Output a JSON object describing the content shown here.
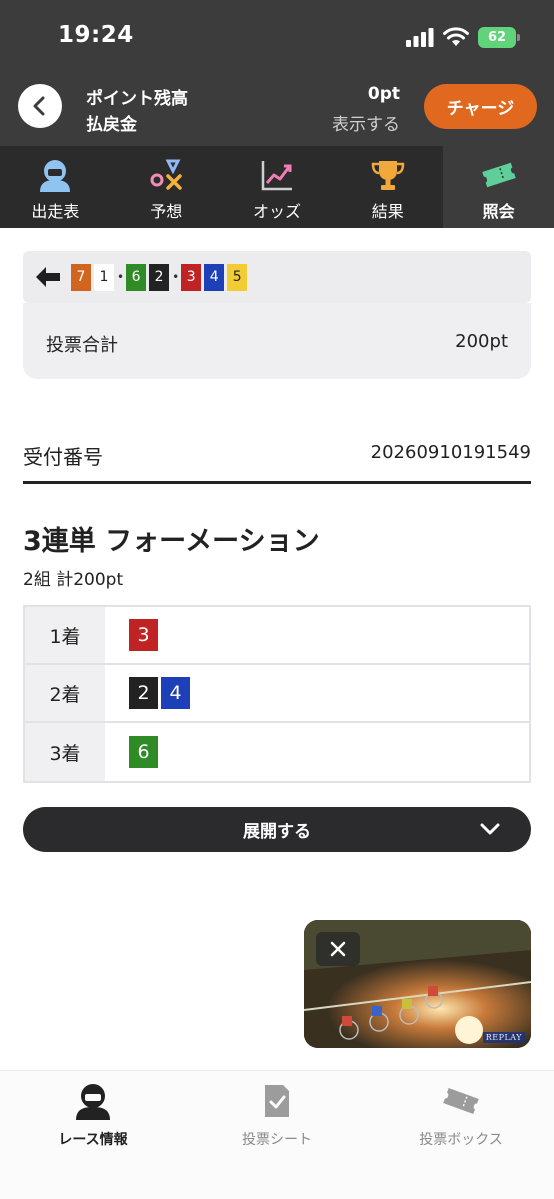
{
  "status_bar": {
    "time": "19:24",
    "battery": "62"
  },
  "header": {
    "point_label": "ポイント残高",
    "refund_label": "払戻金",
    "point_value": "0pt",
    "show_link": "表示する",
    "charge_label": "チャージ"
  },
  "tabs": [
    {
      "label": "出走表",
      "icon": "racer-icon"
    },
    {
      "label": "予想",
      "icon": "prediction-icon"
    },
    {
      "label": "オッズ",
      "icon": "odds-chart-icon"
    },
    {
      "label": "結果",
      "icon": "trophy-icon"
    },
    {
      "label": "照会",
      "icon": "ticket-icon",
      "active": true
    }
  ],
  "ticket": {
    "combo": [
      {
        "num": "7",
        "color": "#d2651e"
      },
      {
        "num": "1",
        "color": "#ffffff"
      },
      {
        "num": "6",
        "color": "#2e8b26"
      },
      {
        "num": "2",
        "color": "#222222"
      },
      {
        "num": "3",
        "color": "#c02323"
      },
      {
        "num": "4",
        "color": "#1d3fb8"
      },
      {
        "num": "5",
        "color": "#f3cc33"
      }
    ],
    "total_label": "投票合計",
    "total_value": "200pt"
  },
  "receipt": {
    "label": "受付番号",
    "number": "20260910191549"
  },
  "bet": {
    "title": "3連単 フォーメーション",
    "subtitle": "2組 計200pt",
    "rows": [
      {
        "label": "1着",
        "nums": [
          {
            "num": "3",
            "color": "#c02323"
          }
        ]
      },
      {
        "label": "2着",
        "nums": [
          {
            "num": "2",
            "color": "#222222"
          },
          {
            "num": "4",
            "color": "#1d3fb8"
          }
        ]
      },
      {
        "label": "3着",
        "nums": [
          {
            "num": "6",
            "color": "#2e8b26"
          }
        ]
      }
    ]
  },
  "expand_label": "展開する",
  "video": {
    "badge": "REPLAY"
  },
  "bottom_nav": [
    {
      "label": "レース情報",
      "icon": "racer-icon",
      "active": true
    },
    {
      "label": "投票シート",
      "icon": "vote-sheet-icon"
    },
    {
      "label": "投票ボックス",
      "icon": "ticket-box-icon"
    }
  ]
}
